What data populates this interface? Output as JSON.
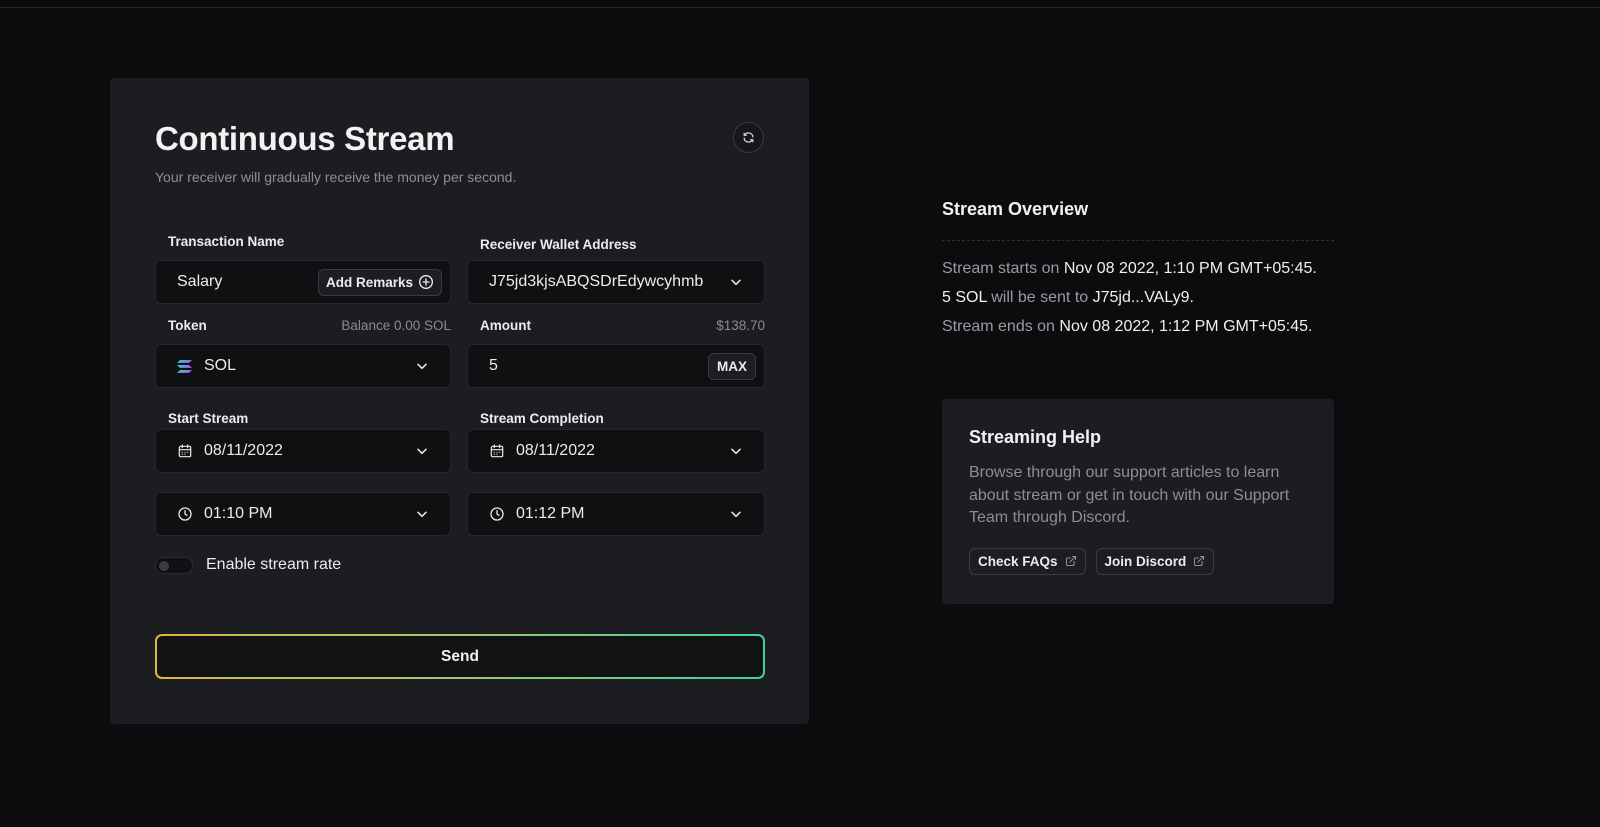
{
  "form": {
    "title": "Continuous Stream",
    "subtitle": "Your receiver will gradually receive the money per second.",
    "transaction_name_label": "Transaction Name",
    "transaction_name_value": "Salary",
    "add_remarks_label": "Add Remarks",
    "receiver_label": "Receiver Wallet Address",
    "receiver_value": "J75jd3kjsABQSDrEdywcyhmb",
    "token_label": "Token",
    "balance_text": "Balance 0.00 SOL",
    "token_value": "SOL",
    "amount_label": "Amount",
    "amount_usd": "$138.70",
    "amount_value": "5",
    "max_label": "MAX",
    "start_label": "Start Stream",
    "start_date": "08/11/2022",
    "start_time": "01:10 PM",
    "completion_label": "Stream Completion",
    "end_date": "08/11/2022",
    "end_time": "01:12 PM",
    "stream_rate_label": "Enable stream rate",
    "stream_rate_enabled": false,
    "send_label": "Send"
  },
  "overview": {
    "title": "Stream Overview",
    "start_prefix": "Stream starts on",
    "start_value": "Nov 08 2022, 1:10 PM GMT+05:45.",
    "amount_text": "5 SOL",
    "sent_to_text": "will be sent to",
    "recipient_short": "J75jd...VALy9.",
    "end_prefix": "Stream ends on",
    "end_value": "Nov 08 2022, 1:12 PM GMT+05:45."
  },
  "help": {
    "title": "Streaming Help",
    "text": "Browse through our support articles to learn about stream or get in touch with our Support Team through Discord.",
    "faq_label": "Check FAQs",
    "discord_label": "Join Discord"
  },
  "colors": {
    "background": "#0c0c0e",
    "card": "#1c1d21",
    "field": "#0f1012",
    "send_gradient_start": "#d9b845",
    "send_gradient_end": "#3fd29c"
  },
  "icons": [
    "refresh-icon",
    "plus-circle-icon",
    "chevron-down-icon",
    "solana-icon",
    "calendar-icon",
    "clock-icon",
    "external-link-icon"
  ]
}
